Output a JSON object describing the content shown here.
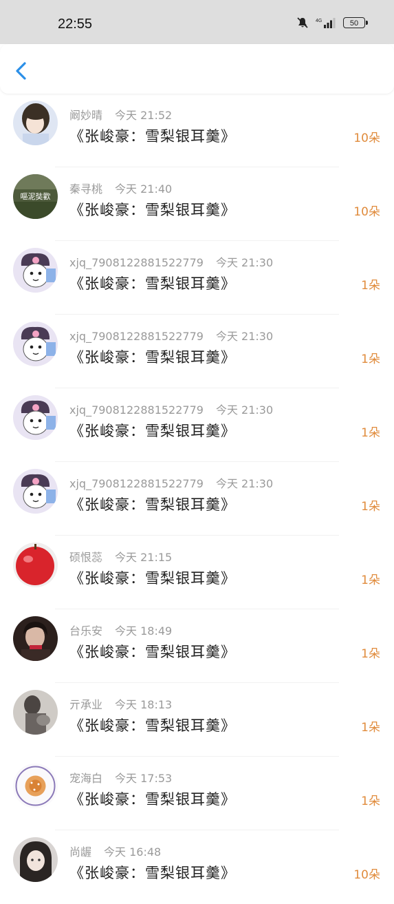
{
  "status_bar": {
    "time": "22:55",
    "battery": "50",
    "icons": [
      "mute-bell-icon",
      "signal-icon",
      "battery-icon"
    ]
  },
  "nav": {
    "back_icon": "chevron-left-icon",
    "accent_color": "#2b8fe8"
  },
  "records": [
    {
      "user": "阚妙晴",
      "time": "今天 21:52",
      "gift": "《张峻豪：雪梨银耳羹》",
      "count": "10朵",
      "avatar": "girl-photo"
    },
    {
      "user": "秦寻桃",
      "time": "今天 21:40",
      "gift": "《张峻豪：雪梨银耳羹》",
      "count": "10朵",
      "avatar": "text-badge"
    },
    {
      "user": "xjq_7908122881522779",
      "time": "今天 21:30",
      "gift": "《张峻豪：雪梨银耳羹》",
      "count": "1朵",
      "avatar": "kuromi"
    },
    {
      "user": "xjq_7908122881522779",
      "time": "今天 21:30",
      "gift": "《张峻豪：雪梨银耳羹》",
      "count": "1朵",
      "avatar": "kuromi"
    },
    {
      "user": "xjq_7908122881522779",
      "time": "今天 21:30",
      "gift": "《张峻豪：雪梨银耳羹》",
      "count": "1朵",
      "avatar": "kuromi"
    },
    {
      "user": "xjq_7908122881522779",
      "time": "今天 21:30",
      "gift": "《张峻豪：雪梨银耳羹》",
      "count": "1朵",
      "avatar": "kuromi"
    },
    {
      "user": "硕恨蕊",
      "time": "今天 21:15",
      "gift": "《张峻豪：雪梨银耳羹》",
      "count": "1朵",
      "avatar": "red-apple"
    },
    {
      "user": "台乐安",
      "time": "今天 18:49",
      "gift": "《张峻豪：雪梨银耳羹》",
      "count": "1朵",
      "avatar": "dark-portrait"
    },
    {
      "user": "亓承业",
      "time": "今天 18:13",
      "gift": "《张峻豪：雪梨银耳羹》",
      "count": "1朵",
      "avatar": "gray-portrait"
    },
    {
      "user": "宠海白",
      "time": "今天 17:53",
      "gift": "《张峻豪：雪梨银耳羹》",
      "count": "1朵",
      "avatar": "bakery-badge"
    },
    {
      "user": "尚龌",
      "time": "今天 16:48",
      "gift": "《张峻豪：雪梨银耳羹》",
      "count": "10朵",
      "avatar": "anime-girl"
    }
  ],
  "avatar_badge_text": "嘔泥奘歡",
  "colors": {
    "count": "#e08b3c",
    "meta": "#9a9a9a",
    "gift": "#222222"
  }
}
